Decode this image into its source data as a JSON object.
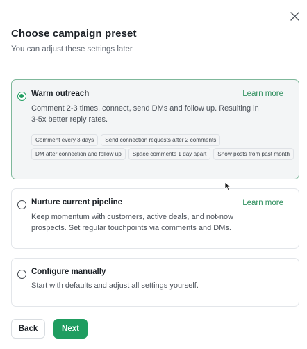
{
  "dialog": {
    "title": "Choose campaign preset",
    "subtitle": "You can adjust these settings later"
  },
  "presets": [
    {
      "title": "Warm outreach",
      "link": "Learn more",
      "description": "Comment 2-3 times, connect, send DMs and follow up. Resulting in 3-5x better reply rates.",
      "selected": true,
      "tags": [
        "Comment every 3 days",
        "Send connection requests after 2 comments",
        "DM after connection and follow up",
        "Space comments 1 day apart",
        "Show posts from past month"
      ]
    },
    {
      "title": "Nurture current pipeline",
      "link": "Learn more",
      "description": "Keep momentum with customers, active deals, and not-now prospects. Set regular touchpoints via comments and DMs.",
      "selected": false
    },
    {
      "title": "Configure manually",
      "description": "Start with defaults and adjust all settings yourself.",
      "selected": false
    }
  ],
  "footer": {
    "back_label": "Back",
    "next_label": "Next"
  },
  "colors": {
    "accent": "#1f9d60",
    "link": "#2f8f5e",
    "selected_bg": "#f3f5f6"
  }
}
